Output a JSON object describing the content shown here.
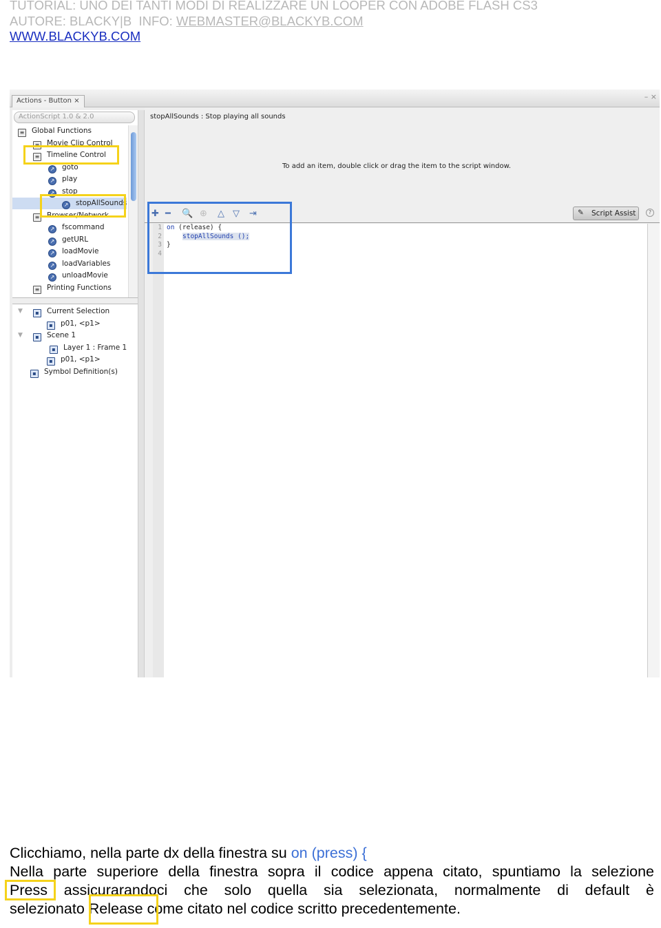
{
  "header": {
    "line1": "TUTORIAL: UNO DEI TANTI MODI DI REALIZZARE UN LOOPER CON ADOBE FLASH CS3",
    "line2_prefix": "AUTORE: BLACKY|B  INFO: ",
    "email": "WEBMASTER@BLACKYB.COM",
    "website": "WWW.BLACKYB.COM"
  },
  "panel": {
    "tab": "Actions - Button",
    "tab_close": "×",
    "window_controls": "– ×",
    "version_select": "ActionScript 1.0 & 2.0",
    "tree": [
      {
        "label": "Global Functions",
        "icon": "book-icon"
      },
      {
        "label": "Movie Clip Control",
        "icon": "book-icon"
      },
      {
        "label": "Timeline Control",
        "icon": "book-icon"
      },
      {
        "label": "goto",
        "icon": "action-icon"
      },
      {
        "label": "play",
        "icon": "action-icon"
      },
      {
        "label": "stop",
        "icon": "action-icon"
      },
      {
        "label": "stopAllSounds",
        "icon": "action-icon",
        "selected": true
      },
      {
        "label": "Browser/Network",
        "icon": "book-icon"
      },
      {
        "label": "fscommand",
        "icon": "action-icon"
      },
      {
        "label": "getURL",
        "icon": "action-icon"
      },
      {
        "label": "loadMovie",
        "icon": "action-icon"
      },
      {
        "label": "loadVariables",
        "icon": "action-icon"
      },
      {
        "label": "unloadMovie",
        "icon": "action-icon"
      },
      {
        "label": "Printing Functions",
        "icon": "book-icon"
      }
    ],
    "lower_tree": [
      {
        "label": "Current Selection",
        "icon": "selection-icon"
      },
      {
        "label": "p01, <p1>",
        "icon": "button-symbol-icon"
      },
      {
        "label": "Scene 1",
        "icon": "scene-icon"
      },
      {
        "label": "Layer 1 : Frame 1",
        "icon": "frame-icon"
      },
      {
        "label": "p01, <p1>",
        "icon": "button-symbol-icon"
      },
      {
        "label": "Symbol Definition(s)",
        "icon": "symbols-icon"
      }
    ],
    "description": "stopAllSounds : Stop playing all sounds",
    "hint": "To add an item, double click or drag the item to the script window.",
    "script_assist": "Script Assist",
    "help": "?",
    "line_numbers": [
      "1",
      "2",
      "3",
      "4"
    ],
    "code": {
      "kw_on": "on",
      "event": " (release) {",
      "call": "stopAllSounds ();",
      "close": "}"
    }
  },
  "body": {
    "line1": "Clicchiamo, nella parte dx della finestra su ",
    "line1_code": "on (press) {",
    "line2": "Nella parte superiore della finestra sopra il codice appena citato, spuntiamo la selezione",
    "line3": "Press assicurarandoci che solo quella sia selezionata, normalmente di default è",
    "line4": "selezionato Release come citato nel codice scritto precedentemente."
  },
  "colors": {
    "highlight_box": "#f5d21a",
    "toolbar_box": "#3b78d8",
    "link": "#1a2fc0",
    "code_keyword": "#1f3fae"
  }
}
